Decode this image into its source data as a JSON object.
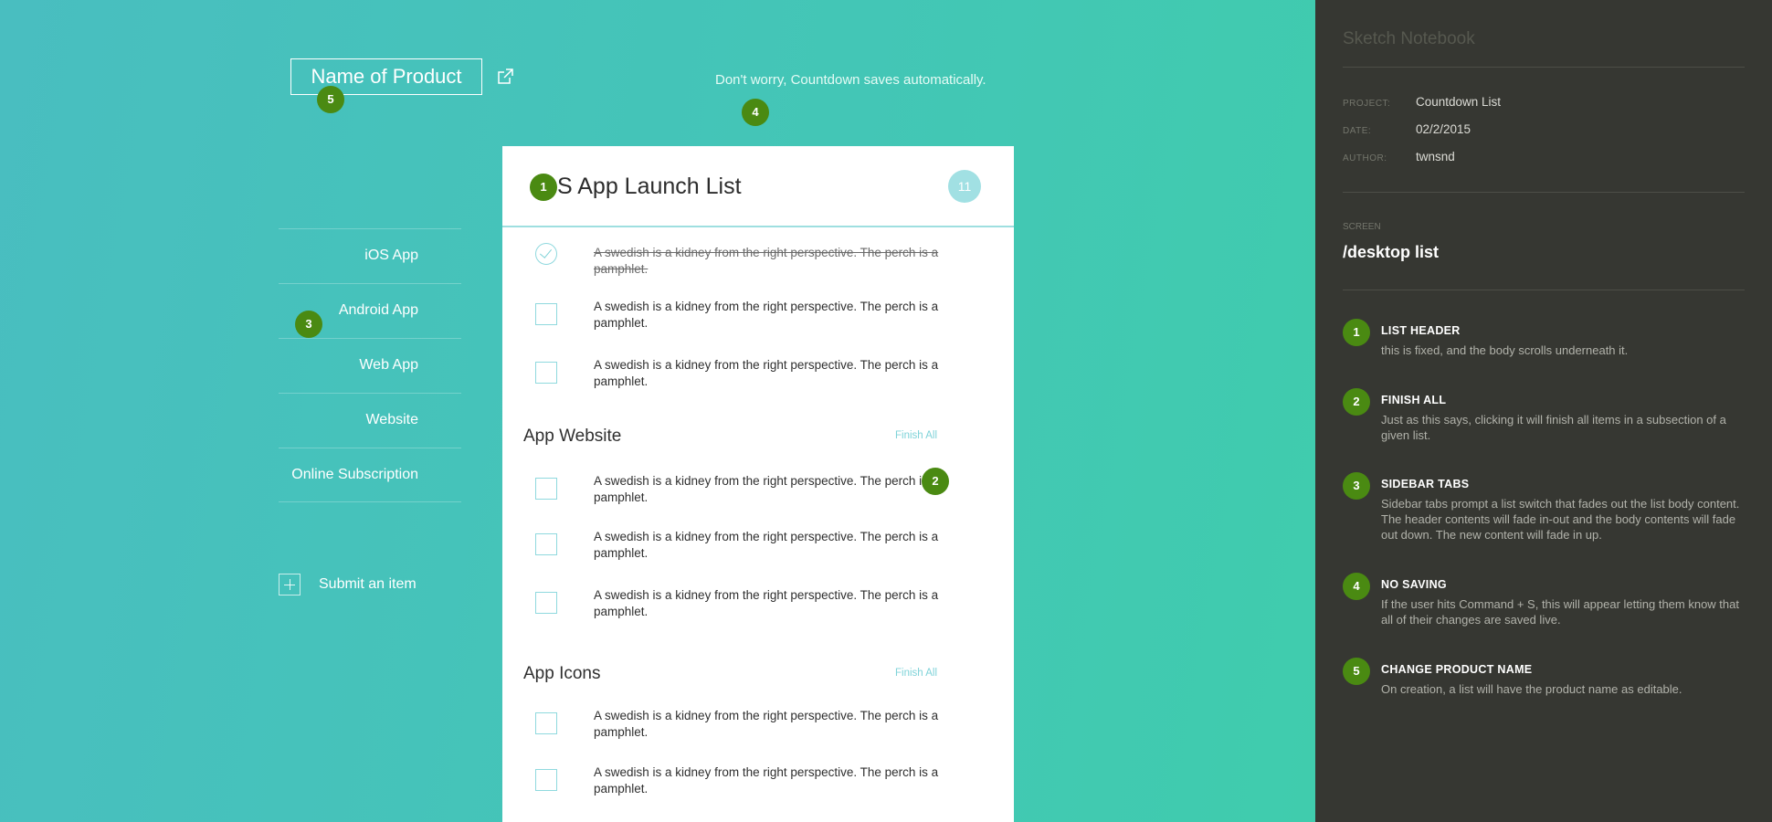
{
  "header": {
    "product_name": "Name of Product",
    "autosave_message": "Don't worry, Countdown saves automatically."
  },
  "annotations": {
    "marker_1": "1",
    "marker_2": "2",
    "marker_3": "3",
    "marker_4": "4",
    "marker_5": "5"
  },
  "sidebar": {
    "items": [
      {
        "label": "iOS App"
      },
      {
        "label": "Android App"
      },
      {
        "label": "Web App"
      },
      {
        "label": "Website"
      },
      {
        "label": "Online Subscription"
      }
    ],
    "submit_label": "Submit an item"
  },
  "list": {
    "title": "S App Launch List",
    "count": "11",
    "item_text": "A swedish is a kidney from the right perspective. The perch is a pamphlet.",
    "sections": [
      {
        "title": "App Website",
        "action": "Finish All"
      },
      {
        "title": "App Icons",
        "action": "Finish All"
      }
    ]
  },
  "notes": {
    "title": "Sketch Notebook",
    "project_label": "PROJECT:",
    "project_value": "Countdown List",
    "date_label": "DATE:",
    "date_value": "02/2/2015",
    "author_label": "AUTHOR:",
    "author_value": "twnsnd",
    "screen_label": "SCREEN",
    "screen_value": "/desktop list",
    "entries": [
      {
        "num": "1",
        "title": "LIST HEADER",
        "body": "this is fixed, and the body scrolls underneath it."
      },
      {
        "num": "2",
        "title": "FINISH ALL",
        "body": "Just as this says, clicking it will finish all items in a subsection of a given list."
      },
      {
        "num": "3",
        "title": "SIDEBAR TABS",
        "body": "Sidebar tabs prompt a list switch that fades out the list body content. The header contents will fade in-out and the body contents will fade out down. The new content will fade in up."
      },
      {
        "num": "4",
        "title": "NO SAVING",
        "body": "If the user hits Command + S, this will appear letting them know that all of their changes are saved live."
      },
      {
        "num": "5",
        "title": "CHANGE PRODUCT NAME",
        "body": "On creation, a list will have the product name as editable."
      }
    ]
  },
  "colors": {
    "accent": "#4a8a12",
    "teal_light": "#9edfe0",
    "panel_bg": "#363732"
  }
}
